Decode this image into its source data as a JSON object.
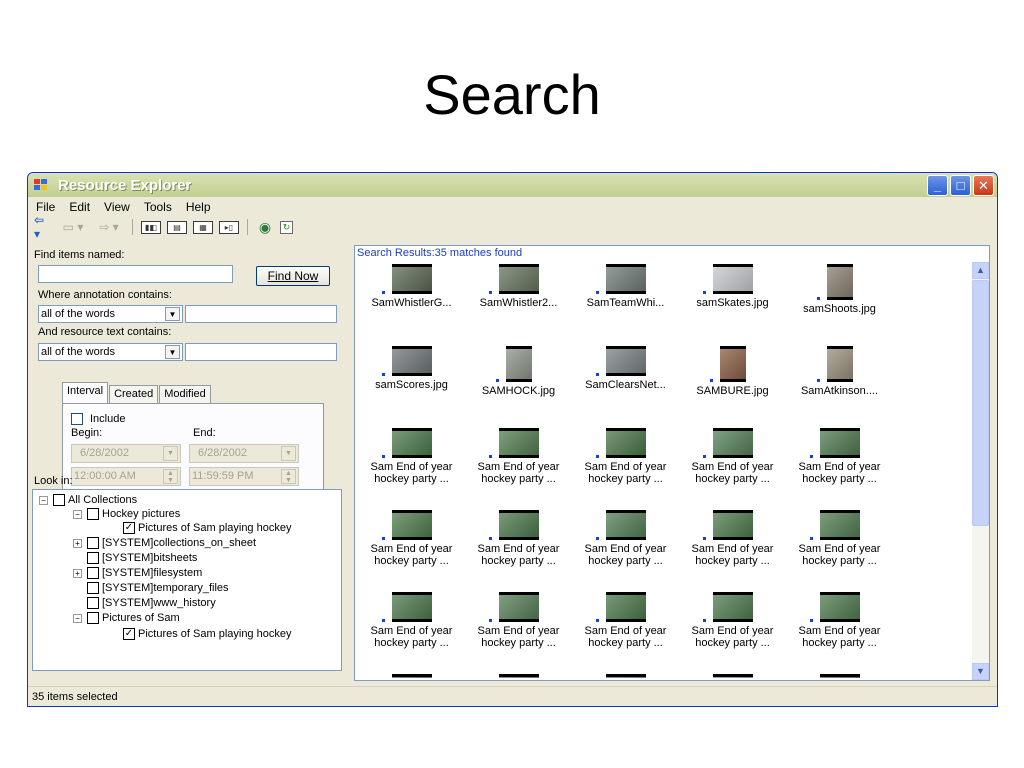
{
  "slide": {
    "title": "Search"
  },
  "window": {
    "title": "Resource Explorer",
    "buttons": {
      "minimize": "_",
      "maximize": "□",
      "close": "✕"
    }
  },
  "menu": [
    "File",
    "Edit",
    "View",
    "Tools",
    "Help"
  ],
  "search": {
    "find_label": "Find items named:",
    "find_value": "",
    "find_button": "Find Now",
    "annotation_label": "Where annotation contains:",
    "annotation_mode": "all of the words",
    "annotation_value": "",
    "resource_label": "And resource text contains:",
    "resource_mode": "all of the words",
    "resource_value": ""
  },
  "date_tabs": [
    "Interval",
    "Created",
    "Modified"
  ],
  "date_filter": {
    "include_label": "Include",
    "include_checked": false,
    "begin_label": "Begin:",
    "end_label": "End:",
    "begin_date": "6/28/2002",
    "end_date": "6/28/2002",
    "begin_time": "12:00:00 AM",
    "end_time": "11:59:59 PM"
  },
  "look_in_label": "Look in:",
  "tree": [
    {
      "label": "All Collections",
      "expander": "−",
      "checked": false
    },
    {
      "label": "Hockey pictures",
      "expander": "−",
      "checked": false
    },
    {
      "label": "Pictures of Sam playing hockey",
      "expander": "",
      "checked": true
    },
    {
      "label": "[SYSTEM]collections_on_sheet",
      "expander": "+",
      "checked": false
    },
    {
      "label": "[SYSTEM]bitsheets",
      "expander": "",
      "checked": false
    },
    {
      "label": "[SYSTEM]filesystem",
      "expander": "+",
      "checked": false
    },
    {
      "label": "[SYSTEM]temporary_files",
      "expander": "",
      "checked": false
    },
    {
      "label": "[SYSTEM]www_history",
      "expander": "",
      "checked": false
    },
    {
      "label": "Pictures of Sam",
      "expander": "−",
      "checked": false
    },
    {
      "label": "Pictures of Sam playing hockey",
      "expander": "",
      "checked": true
    }
  ],
  "results": {
    "header": "Search Results:35 matches found",
    "items": [
      {
        "line1": "SamWhistlerG...",
        "line2": "",
        "color": "#5b6a55"
      },
      {
        "line1": "SamWhistler2...",
        "line2": "",
        "color": "#66745e"
      },
      {
        "line1": "SamTeamWhi...",
        "line2": "",
        "color": "#707b78"
      },
      {
        "line1": "samSkates.jpg",
        "line2": "",
        "color": "#c7c9cc"
      },
      {
        "line1": "samShoots.jpg",
        "line2": "",
        "color": "#8a8070"
      },
      {
        "line1": "samScores.jpg",
        "line2": "",
        "color": "#707678"
      },
      {
        "line1": "SAMHOCK.jpg",
        "line2": "",
        "color": "#8d948a"
      },
      {
        "line1": "SamClearsNet...",
        "line2": "",
        "color": "#7a8284"
      },
      {
        "line1": "SAMBURE.jpg",
        "line2": "",
        "color": "#8a5e44"
      },
      {
        "line1": "SamAtkinson....",
        "line2": "",
        "color": "#9a8f7c"
      },
      {
        "line1": "Sam End of year",
        "line2": "hockey party ...",
        "color": "#4d7a4c"
      },
      {
        "line1": "Sam End of year",
        "line2": "hockey party ...",
        "color": "#527e50"
      },
      {
        "line1": "Sam End of year",
        "line2": "hockey party ...",
        "color": "#4a7648"
      },
      {
        "line1": "Sam End of year",
        "line2": "hockey party ...",
        "color": "#56805a"
      },
      {
        "line1": "Sam End of year",
        "line2": "hockey party ...",
        "color": "#4f7a50"
      },
      {
        "line1": "Sam End of year",
        "line2": "hockey party ...",
        "color": "#507c4f"
      },
      {
        "line1": "Sam End of year",
        "line2": "hockey party ...",
        "color": "#4b784c"
      },
      {
        "line1": "Sam End of year",
        "line2": "hockey party ...",
        "color": "#547f55"
      },
      {
        "line1": "Sam End of year",
        "line2": "hockey party ...",
        "color": "#4e7b4e"
      },
      {
        "line1": "Sam End of year",
        "line2": "hockey party ...",
        "color": "#527d52"
      },
      {
        "line1": "Sam End of year",
        "line2": "hockey party ...",
        "color": "#4d794d"
      },
      {
        "line1": "Sam End of year",
        "line2": "hockey party ...",
        "color": "#557f56"
      },
      {
        "line1": "Sam End of year",
        "line2": "hockey party ...",
        "color": "#4c784b"
      },
      {
        "line1": "Sam End of year",
        "line2": "hockey party ...",
        "color": "#517c50"
      },
      {
        "line1": "Sam End of year",
        "line2": "hockey party ...",
        "color": "#4f7b4f"
      },
      {
        "line1": "",
        "line2": "",
        "color": "#556b55"
      },
      {
        "line1": "",
        "line2": "",
        "color": "#7a6d60"
      },
      {
        "line1": "",
        "line2": "",
        "color": "#6a6f8c"
      },
      {
        "line1": "",
        "line2": "",
        "color": "#8c8c8c"
      },
      {
        "line1": "",
        "line2": "",
        "color": "#6e5e50"
      }
    ]
  },
  "status": "35 items selected",
  "colors": {
    "title_bar": "#c2cf92",
    "window_bg": "#ece9d8",
    "header_text": "#1c3cc4",
    "pic_marker": "#1a3fd1"
  },
  "icons": [
    "back-arrow-icon",
    "folder-up-icon",
    "forward-arrow-icon",
    "view-mode-icon",
    "search-globe-icon",
    "refresh-icon"
  ]
}
